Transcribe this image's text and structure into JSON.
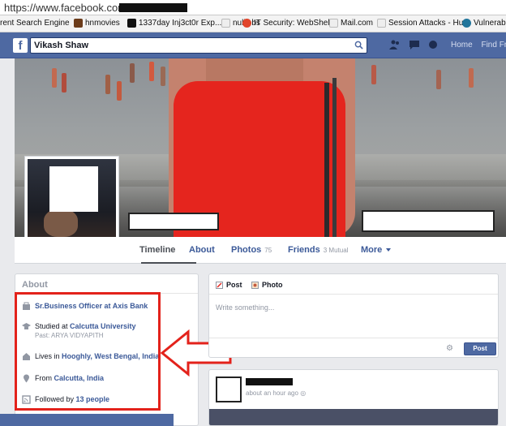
{
  "browser": {
    "url": "https://www.facebook.com"
  },
  "bookmarks": [
    {
      "label": "rent Search Engine",
      "icon": "search-engine-icon",
      "color": "#3b73d1"
    },
    {
      "label": "hnmovies",
      "icon": "movie-icon",
      "color": "#6b3b1a"
    },
    {
      "label": "1337day Inj3ct0r Exp...",
      "icon": "exploit-icon",
      "color": "#111111"
    },
    {
      "label": "nulljobs",
      "icon": "page-icon",
      "color": "#dddddd"
    },
    {
      "label": "IT Security: WebShel...",
      "icon": "security-icon",
      "color": "#e1452b"
    },
    {
      "label": "Mail.com",
      "icon": "mail-icon",
      "color": "#dddddd"
    },
    {
      "label": "Session Attacks - Hu...",
      "icon": "page-icon",
      "color": "#dddddd"
    },
    {
      "label": "Vulnerable",
      "icon": "wordpress-icon",
      "color": "#21759b"
    }
  ],
  "header": {
    "logo": "f",
    "search_value": "Vikash Shaw",
    "nav": [
      "Home",
      "Find Frie"
    ]
  },
  "profile": {
    "tabs": [
      {
        "label": "Timeline",
        "count": "",
        "active": true
      },
      {
        "label": "About",
        "count": ""
      },
      {
        "label": "Photos",
        "count": "75"
      },
      {
        "label": "Friends",
        "count": "3 Mutual"
      },
      {
        "label": "More",
        "count": ""
      }
    ]
  },
  "about": {
    "title": "About",
    "items": [
      {
        "pre": "",
        "bold": "Sr.Business Officer at Axis Bank",
        "sub": "",
        "icon": "work-icon"
      },
      {
        "pre": "Studied at ",
        "bold": "Calcutta University",
        "sub": "Past: ARYA VIDYAPITH",
        "icon": "education-icon"
      },
      {
        "pre": "Lives in ",
        "bold": "Hooghly, West Bengal, India",
        "sub": "",
        "icon": "home-icon"
      },
      {
        "pre": "From ",
        "bold": "Calcutta, India",
        "sub": "",
        "icon": "location-pin-icon"
      },
      {
        "pre": "Followed by ",
        "bold": "13 people",
        "sub": "",
        "icon": "followers-icon"
      }
    ]
  },
  "composer": {
    "tab_post": "Post",
    "tab_photo": "Photo",
    "placeholder": "Write something...",
    "post_button": "Post"
  },
  "feed": {
    "time": "about an hour ago"
  },
  "colors": {
    "facebook_blue": "#4e69a2",
    "annotation_red": "#e3221b",
    "link_blue": "#3b5998"
  }
}
